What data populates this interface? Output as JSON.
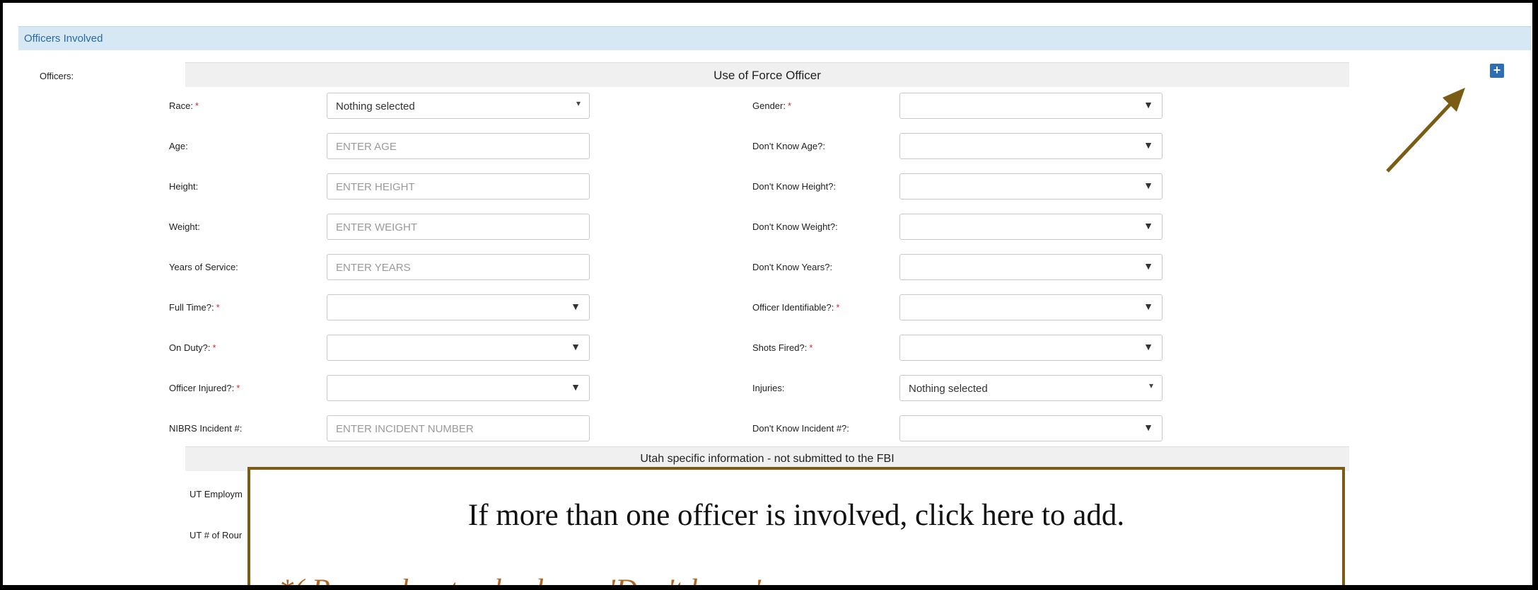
{
  "section": {
    "title": "Officers Involved"
  },
  "officers_label": "Officers:",
  "use_of_force_header": "Use of Force Officer",
  "left_fields": [
    {
      "label": "Race:",
      "required": true,
      "kind": "multiselect",
      "value": "Nothing selected",
      "placeholder": ""
    },
    {
      "label": "Age:",
      "required": false,
      "kind": "input",
      "value": "",
      "placeholder": "ENTER AGE"
    },
    {
      "label": "Height:",
      "required": false,
      "kind": "input",
      "value": "",
      "placeholder": "ENTER HEIGHT"
    },
    {
      "label": "Weight:",
      "required": false,
      "kind": "input",
      "value": "",
      "placeholder": "ENTER WEIGHT"
    },
    {
      "label": "Years of Service:",
      "required": false,
      "kind": "input",
      "value": "",
      "placeholder": "ENTER YEARS"
    },
    {
      "label": "Full Time?:",
      "required": true,
      "kind": "select",
      "value": "",
      "placeholder": ""
    },
    {
      "label": "On Duty?:",
      "required": true,
      "kind": "select",
      "value": "",
      "placeholder": ""
    },
    {
      "label": "Officer Injured?:",
      "required": true,
      "kind": "select",
      "value": "",
      "placeholder": ""
    },
    {
      "label": "NIBRS Incident #:",
      "required": false,
      "kind": "input",
      "value": "",
      "placeholder": "ENTER INCIDENT NUMBER"
    }
  ],
  "right_fields": [
    {
      "label": "Gender:",
      "required": true,
      "kind": "select",
      "value": ""
    },
    {
      "label": "Don't Know Age?:",
      "required": false,
      "kind": "select",
      "value": ""
    },
    {
      "label": "Don't Know Height?:",
      "required": false,
      "kind": "select",
      "value": ""
    },
    {
      "label": "Don't Know Weight?:",
      "required": false,
      "kind": "select",
      "value": ""
    },
    {
      "label": "Don't Know Years?:",
      "required": false,
      "kind": "select",
      "value": ""
    },
    {
      "label": "Officer Identifiable?:",
      "required": true,
      "kind": "select",
      "value": ""
    },
    {
      "label": "Shots Fired?:",
      "required": true,
      "kind": "select",
      "value": ""
    },
    {
      "label": "Injuries:",
      "required": false,
      "kind": "multiselect",
      "value": "Nothing selected"
    },
    {
      "label": "Don't Know Incident #?:",
      "required": false,
      "kind": "select",
      "value": ""
    }
  ],
  "required_marker": "*",
  "utah_header": "Utah specific information - not submitted to the FBI",
  "utah_fields": [
    {
      "label": "UT Employm"
    },
    {
      "label": "UT # of Rour"
    }
  ],
  "add_button": {
    "symbol": "+",
    "icon": "plus-icon"
  },
  "callout": {
    "main_text": "If more than one officer is involved, click here to add.",
    "note_text": "*( Remember to check any 'Don't know' or",
    "border_color": "#7a5c14",
    "note_color": "#b5651d"
  },
  "colors": {
    "section_bar": "#d5e8f3",
    "section_title": "#2a6aa0",
    "required": "#d9232d",
    "add_button": "#2f6db4",
    "arrow": "#7a5c14"
  }
}
